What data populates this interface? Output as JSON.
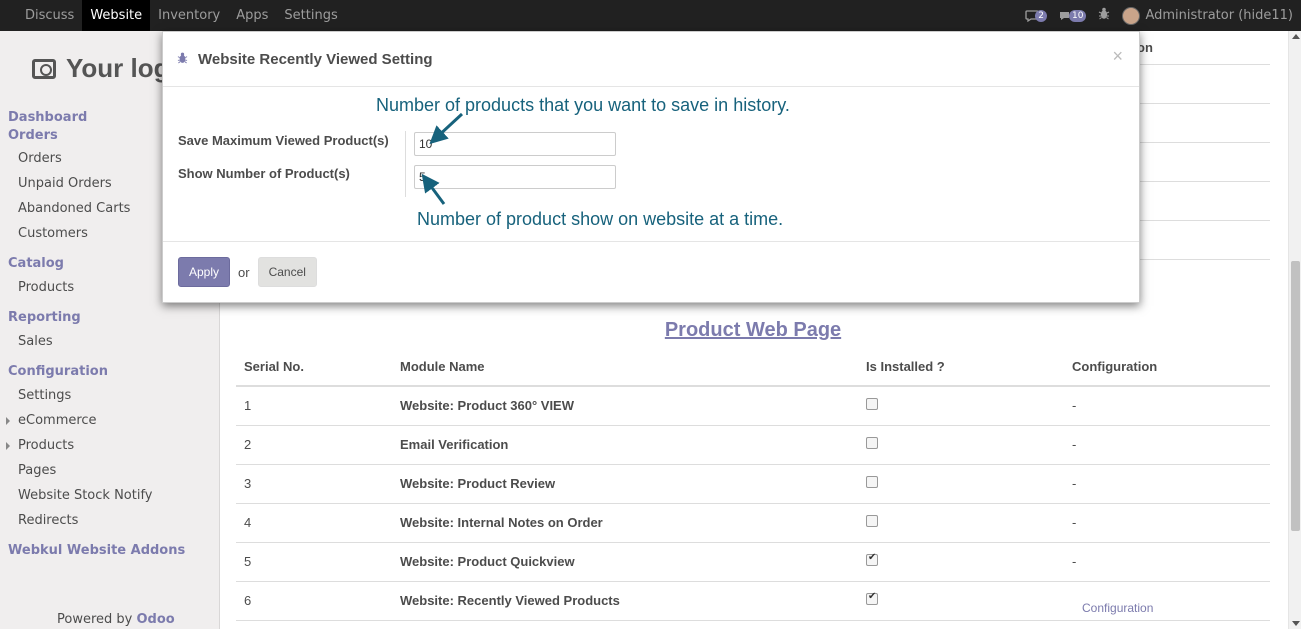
{
  "topbar": {
    "menu": [
      "Discuss",
      "Website",
      "Inventory",
      "Apps",
      "Settings"
    ],
    "active": "Website",
    "conv_count": "2",
    "msg_count": "10",
    "user": "Administrator (hide11)"
  },
  "sidebar": {
    "logo": "Your logo",
    "sections": [
      {
        "head": "Dashboard"
      },
      {
        "head": "Orders",
        "items": [
          "Orders",
          "Unpaid Orders",
          "Abandoned Carts",
          "Customers"
        ]
      },
      {
        "head": "Catalog",
        "items": [
          "Products"
        ]
      },
      {
        "head": "Reporting",
        "items": [
          "Sales"
        ]
      },
      {
        "head": "Configuration",
        "items": [
          "Settings",
          "eCommerce",
          "Products",
          "Pages",
          "Website Stock Notify",
          "Redirects"
        ]
      },
      {
        "head": "Webkul Website Addons"
      }
    ],
    "powered_by": "Powered by",
    "powered_brand": "Odoo"
  },
  "main": {
    "bg_header_fragment": "on",
    "title": "Product Web Page",
    "columns": [
      "Serial No.",
      "Module Name",
      "Is Installed ?",
      "Configuration"
    ],
    "rows": [
      {
        "serial": "1",
        "name": "Website: Product 360° VIEW",
        "installed": false,
        "config": "-"
      },
      {
        "serial": "2",
        "name": "Email Verification",
        "installed": false,
        "config": "-"
      },
      {
        "serial": "3",
        "name": "Website: Product Review",
        "installed": false,
        "config": "-"
      },
      {
        "serial": "4",
        "name": "Website: Internal Notes on Order",
        "installed": false,
        "config": "-"
      },
      {
        "serial": "5",
        "name": "Website: Product Quickview",
        "installed": true,
        "config": "-"
      },
      {
        "serial": "6",
        "name": "Website: Recently Viewed Products",
        "installed": true,
        "config": "Configuration"
      }
    ]
  },
  "modal": {
    "title": "Website Recently Viewed Setting",
    "close": "×",
    "field1_label": "Save Maximum Viewed Product(s)",
    "field1_value": "10",
    "field2_label": "Show Number of Product(s)",
    "field2_value": "5",
    "note1": "Number of products that you want to save in history.",
    "note2": "Number of product show on website at a time.",
    "apply": "Apply",
    "or": "or",
    "cancel": "Cancel"
  },
  "colors": {
    "accent": "#7c7bad",
    "note": "#17627c",
    "topbar": "#212121"
  }
}
